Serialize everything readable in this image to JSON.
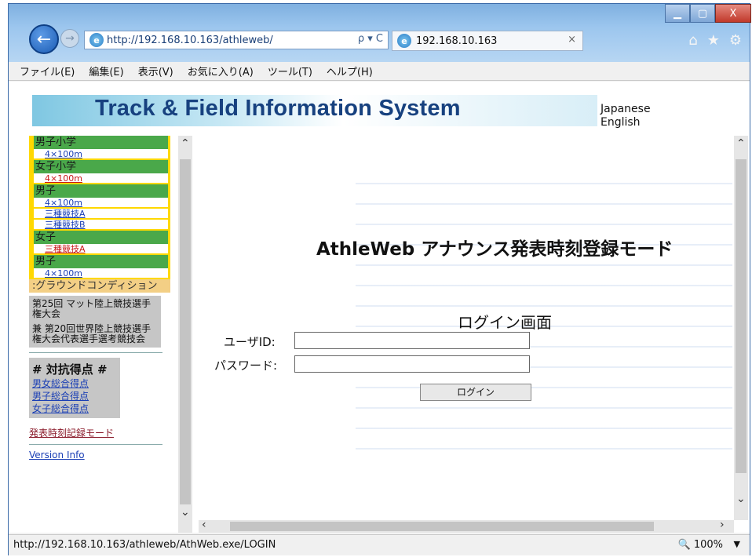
{
  "browser": {
    "address": "http://192.168.10.163/athleweb/",
    "tab_title": "192.168.10.163",
    "tab_close": "×",
    "window_buttons": {
      "minimize": "▁",
      "maximize": "▢",
      "close": "X"
    },
    "nav": {
      "back": "←",
      "forward": "→",
      "search_refresh": "ρ ▾ C"
    },
    "tools": {
      "home": "⌂",
      "favorites": "★",
      "settings": "⚙"
    }
  },
  "menubar": [
    "ファイル(E)",
    "編集(E)",
    "表示(V)",
    "お気に入り(A)",
    "ツール(T)",
    "ヘルプ(H)"
  ],
  "banner": {
    "title": "Track & Field Information System"
  },
  "lang": {
    "japanese": "Japanese",
    "english": "English"
  },
  "sidebar": {
    "groups": [
      {
        "cat": "男子小学",
        "events": [
          {
            "label": "4×100m",
            "red": false
          }
        ]
      },
      {
        "cat": "女子小学",
        "events": [
          {
            "label": "4×100m",
            "red": true
          }
        ]
      },
      {
        "cat": "男子",
        "events": [
          {
            "label": "4×100m",
            "red": false
          },
          {
            "label": "三種競技A",
            "red": false
          },
          {
            "label": "三種競技B",
            "red": false
          }
        ]
      },
      {
        "cat": "女子",
        "events": [
          {
            "label": "三種競技A",
            "red": true
          }
        ]
      },
      {
        "cat": "男子",
        "events": [
          {
            "label": "4×100m",
            "red": false
          }
        ]
      }
    ],
    "ground_condition": ":グラウンドコンディション",
    "meet_name_1": "第25回 マット陸上競技選手権大会",
    "meet_name_2": "兼 第20回世界陸上競技選手権大会代表選手選考競技会",
    "score_title": "# 対抗得点 #",
    "score_links": [
      "男女総合得点",
      "男子総合得点",
      "女子総合得点"
    ],
    "mode_link": "発表時刻記録モード",
    "version_link": "Version Info"
  },
  "main": {
    "heading": "AthleWeb アナウンス発表時刻登録モード",
    "subheading": "ログイン画面",
    "userid_label": "ユーザID:",
    "password_label": "パスワード:",
    "login_button": "ログイン"
  },
  "status": {
    "url": "http://192.168.10.163/athleweb/AthWeb.exe/LOGIN",
    "zoom": "100%"
  }
}
